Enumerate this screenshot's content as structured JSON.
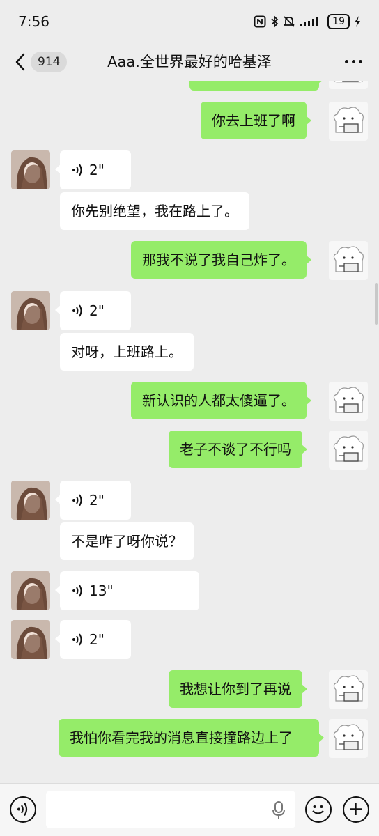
{
  "status_bar": {
    "time": "7:56",
    "battery": "19",
    "icons": [
      "nfc-icon",
      "bluetooth-icon",
      "mute-icon",
      "signal-icon",
      "battery-icon",
      "charging-icon"
    ]
  },
  "navbar": {
    "unread_count": "914",
    "title": "Aaa.全世界最好的哈基泽"
  },
  "messages": [
    {
      "side": "right",
      "type": "text",
      "text": "你去上班了啊"
    },
    {
      "side": "left",
      "type": "voice",
      "duration": "2\""
    },
    {
      "side": "left",
      "type": "text",
      "text": "你先别绝望，我在路上了。"
    },
    {
      "side": "right",
      "type": "text",
      "text": "那我不说了我自己炸了。"
    },
    {
      "side": "left",
      "type": "voice",
      "duration": "2\""
    },
    {
      "side": "left",
      "type": "text",
      "text": "对呀，上班路上。"
    },
    {
      "side": "right",
      "type": "text",
      "text": "新认识的人都太傻逼了。"
    },
    {
      "side": "right",
      "type": "text",
      "text": "老子不谈了不行吗"
    },
    {
      "side": "left",
      "type": "voice",
      "duration": "2\""
    },
    {
      "side": "left",
      "type": "text",
      "text": "不是咋了呀你说？"
    },
    {
      "side": "left",
      "type": "voice",
      "duration": "13\""
    },
    {
      "side": "left",
      "type": "voice",
      "duration": "2\""
    },
    {
      "side": "right",
      "type": "text",
      "text": "我想让你到了再说"
    },
    {
      "side": "right",
      "type": "text",
      "text": "我怕你看完我的消息直接撞路边上了"
    }
  ],
  "colors": {
    "background": "#ededed",
    "my_bubble": "#95ec69",
    "their_bubble": "#ffffff"
  },
  "input_bar": {
    "placeholder": ""
  }
}
